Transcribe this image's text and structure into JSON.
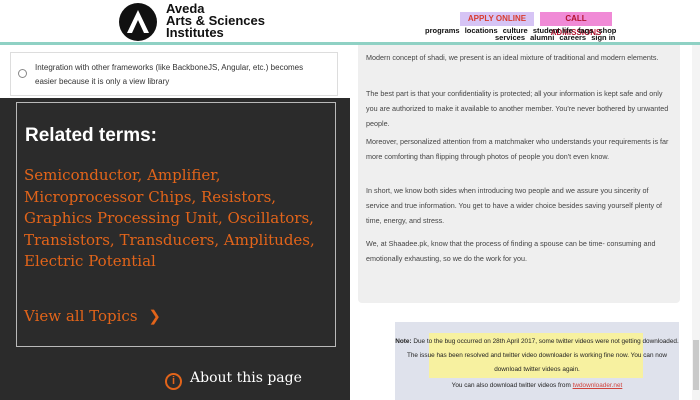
{
  "header": {
    "brand_line1": "Aveda",
    "brand_line2": "Arts & Sciences",
    "brand_line3": "Institutes",
    "apply_label": "APPLY ONLINE",
    "call_label": "CALL ADMISSIONS",
    "nav_row1": [
      "programs",
      "locations",
      "culture",
      "student life",
      "faqs",
      "shop"
    ],
    "nav_row2": [
      "services",
      "alumni",
      "careers",
      "sign in"
    ]
  },
  "left": {
    "radio_option": "Integration with other frameworks (like BackboneJS, Angular, etc.) becomes easier because it is only a view library",
    "related_heading": "Related terms:",
    "terms": [
      "Semiconductor,",
      "Amplifier,",
      "Microprocessor Chips,",
      "Resistors,",
      "Graphics Processing Unit,",
      "Oscillators,",
      "Transistors,",
      "Transducers,",
      "Amplitudes,",
      "Electric Potential"
    ],
    "view_all": "View all Topics",
    "about": "About this page"
  },
  "right": {
    "paragraphs": [
      "Modern concept of shadi, we present is an ideal mixture of traditional and modern elements.",
      "The best part is that your confidentiality is protected; all your information is kept safe and only you are authorized to make it available to another member. You're never bothered by unwanted people.",
      "Moreover, personalized attention from a matchmaker who understands your requirements is far more comforting than flipping through photos of people you don't even know.",
      "In short, we know both sides when introducing two people and we assure you sincerity of service and true information. You get to have a wider choice besides saving yourself plenty of time, energy, and stress.",
      "We, at Shaadee.pk, know that the process of finding a spouse can be time- consuming and emotionally exhausting, so we do the work for you."
    ],
    "notice_label": "Note:",
    "notice_line1": "Due to the bug occurred on 28th April 2017, some twitter videos were not getting downloaded.",
    "notice_line2": "The issue has been resolved and twitter video downloader is working fine now. You can now",
    "notice_line3": "download twitter videos again.",
    "notice_line4": "You can also download twitter videos from",
    "notice_link": "twdownloader.net"
  },
  "colors": {
    "accent_orange": "#e2641a",
    "dark_panel": "#2b2b2b",
    "apply_bg": "#d6c4f5",
    "call_bg": "#f08ad6",
    "header_rule": "#8fd1c4"
  },
  "icons": {
    "logo": "aveda-a-logo-icon",
    "about": "info-circle-icon",
    "radio": "radio-button-icon",
    "chevron": "chevron-right-icon"
  }
}
